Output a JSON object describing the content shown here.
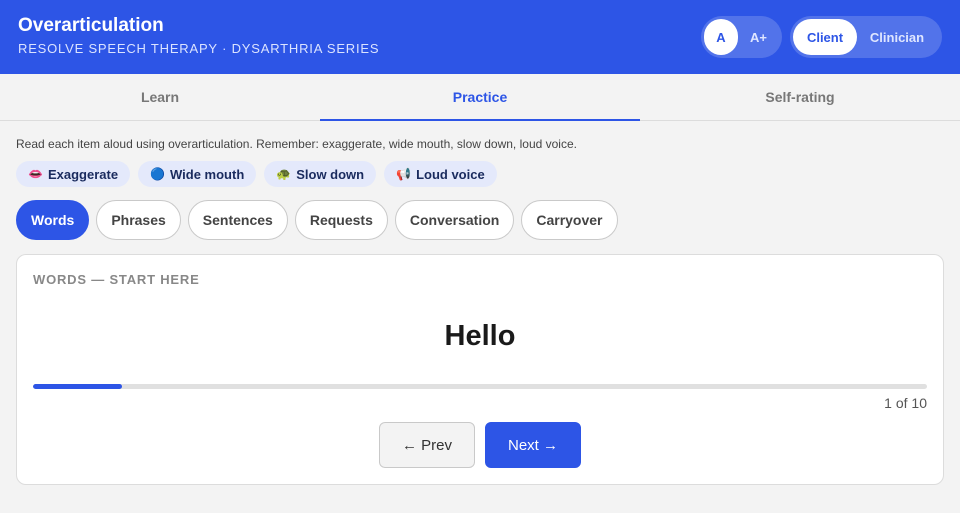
{
  "header": {
    "title": "Overarticulation",
    "subtitle": "RESOLVE SPEECH THERAPY · DYSARTHRIA SERIES",
    "font_size_options": [
      "A",
      "A+"
    ],
    "role_options": [
      "Client",
      "Clinician"
    ]
  },
  "tabs": [
    {
      "label": "Learn",
      "active": false
    },
    {
      "label": "Practice",
      "active": true
    },
    {
      "label": "Self-rating",
      "active": false
    }
  ],
  "instructions": "Read each item aloud using overarticulation. Remember: exaggerate, wide mouth, slow down, loud voice.",
  "cues": [
    {
      "icon": "👄",
      "label": "Exaggerate"
    },
    {
      "icon": "🔵",
      "label": "Wide mouth"
    },
    {
      "icon": "🐢",
      "label": "Slow down"
    },
    {
      "icon": "📢",
      "label": "Loud voice"
    }
  ],
  "levels": [
    "Words",
    "Phrases",
    "Sentences",
    "Requests",
    "Conversation",
    "Carryover"
  ],
  "active_level": "Words",
  "card": {
    "section_label": "WORDS — START HERE",
    "item": "Hello",
    "progress_fraction": 0.1,
    "counter": "1 of 10",
    "prev_label": "← Prev",
    "next_label": "Next →"
  },
  "colors": {
    "accent": "#2d55e6",
    "cue_bg": "#e4e9fb"
  }
}
